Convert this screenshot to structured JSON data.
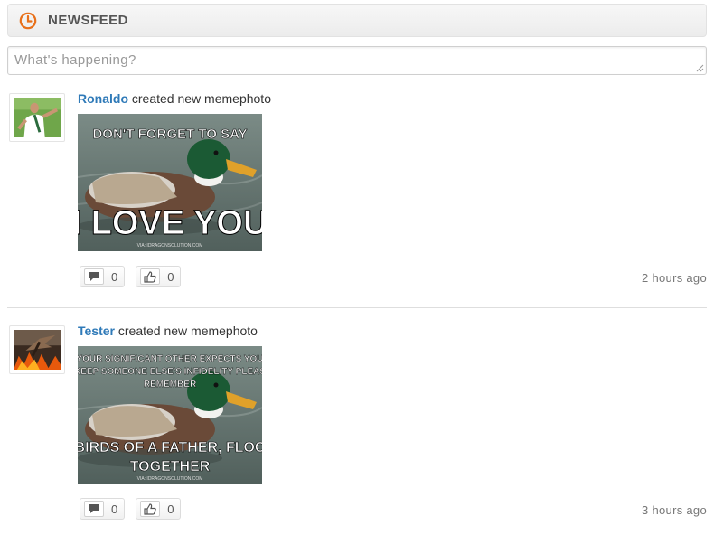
{
  "header": {
    "title": "NEWSFEED",
    "icon": "clock-icon",
    "accent": "#e8701a"
  },
  "composer": {
    "placeholder": "What's happening?",
    "value": ""
  },
  "posts": [
    {
      "user": "Ronaldo",
      "action": "created new memephoto",
      "avatar": "ronaldo-avatar",
      "meme": {
        "top": "DON'T FORGET TO SAY",
        "bottom": "I LOVE YOU",
        "credit": "VIA: IDRAGONSOLUTION.COM"
      },
      "comments": "0",
      "likes": "0",
      "time": "2 hours ago"
    },
    {
      "user": "Tester",
      "action": "created new memephoto",
      "avatar": "dragon-avatar",
      "meme": {
        "top1": "YOUR SIGNIFICANT OTHER EXPECTS YOU",
        "top2": "KEEP SOMEONE ELSE'S INFIDELITY PLEAS",
        "top3": "REMEMBER",
        "bottom1": "BIRDS OF A FATHER, FLOC",
        "bottom2": "TOGETHER",
        "credit": "VIA: IDRAGONSOLUTION.COM"
      },
      "comments": "0",
      "likes": "0",
      "time": "3 hours ago"
    }
  ],
  "link_color": "#2f7ab8"
}
